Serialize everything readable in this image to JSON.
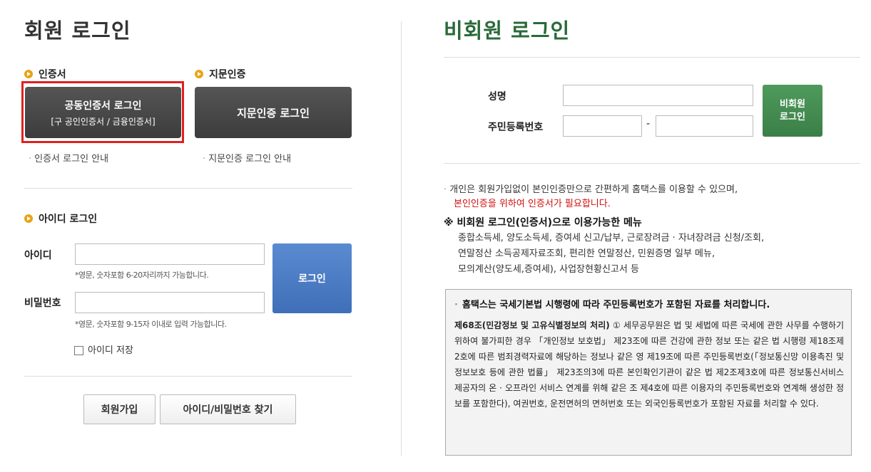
{
  "member": {
    "title": "회원 로그인",
    "cert_section": "인증서",
    "fingerprint_section": "지문인증",
    "cert_btn_main": "공동인증서 로그인",
    "cert_btn_sub": "[구 공인인증서 / 금융인증서]",
    "fingerprint_btn": "지문인증 로그인",
    "cert_guide": "인증서 로그인 안내",
    "fingerprint_guide": "지문인증 로그인 안내",
    "id_section": "아이디 로그인",
    "id_label": "아이디",
    "id_hint": "*영문, 숫자포함 6-20자리까지 가능합니다.",
    "pw_label": "비밀번호",
    "pw_hint": "*영문, 숫자포함 9-15자 이내로 입력 가능합니다.",
    "login_btn": "로그인",
    "save_id": "아이디 저장",
    "join_btn": "회원가입",
    "find_btn": "아이디/비밀번호 찾기"
  },
  "guest": {
    "title": "비회원 로그인",
    "name_label": "성명",
    "rrn_label": "주민등록번호",
    "rrn_sep": "-",
    "login_btn_line1": "비회원",
    "login_btn_line2": "로그인",
    "info_line1": "개인은 회원가입없이 본인인증만으로 간편하게 홈택스를 이용할 수 있으며,",
    "info_line2": "본인인증을 위하여 인증서가 필요합니다.",
    "menu_title": "※ 비회원 로그인(인증서)으로 이용가능한 메뉴",
    "menu_line1": "종합소득세, 양도소득세, 증여세 신고/납부, 근로장려금 · 자녀장려금 신청/조회,",
    "menu_line2": "연말정산 소득공제자료조회, 편리한 연말정산, 민원증명 일부 메뉴,",
    "menu_line3": "모의계산(양도세,증여세), 사업장현황신고서 등",
    "notice_title": "홈택스는 국세기본법 시행령에 따라 주민등록번호가 포함된 자료를 처리합니다.",
    "notice_bold": "제68조(민감정보 및 고유식별정보의 처리)",
    "notice_text": "① 세무공무원은 법 및 세법에 따른 국세에 관한 사무를 수행하기 위하여 불가피한 경우 「개인정보 보호법」 제23조에 따른 건강에 관한 정보 또는 같은 법 시행령 제18조제2호에 따른 범죄경력자료에 해당하는 정보나 같은 영 제19조에 따른 주민등록번호(「정보통신망 이용촉진 및 정보보호 등에 관한 법률」 제23조의3에 따른 본인확인기관이 같은 법 제2조제3호에 따른 정보통신서비스 제공자의 온 · 오프라인 서비스 연계를 위해 같은 조 제4호에 따른 이용자의 주민등록번호와 연계해 생성한 정보를 포함한다), 여권번호, 운전면허의 면허번호 또는 외국인등록번호가 포함된 자료를 처리할 수 있다."
  },
  "colors": {
    "highlight": "#e02020",
    "accent_bullet": "#e8a317",
    "guest_title": "#2a6a3a",
    "login_blue": "#4a7bc4",
    "guest_green": "#45904f"
  }
}
